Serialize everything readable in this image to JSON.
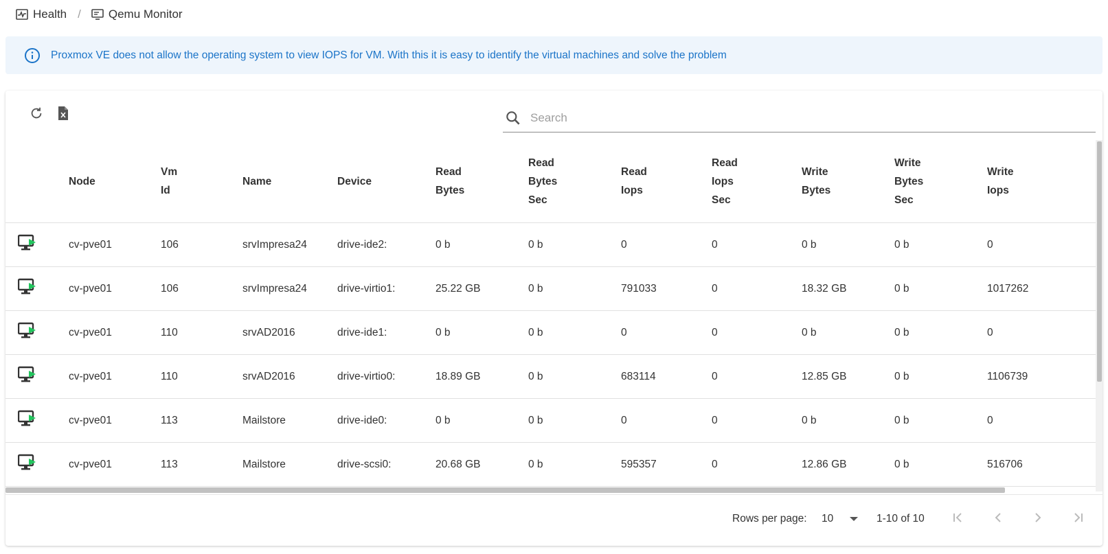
{
  "breadcrumb": {
    "items": [
      {
        "label": "Health",
        "icon": "health-chart-icon"
      },
      {
        "label": "Qemu Monitor",
        "icon": "monitor-icon"
      }
    ],
    "separator": "/"
  },
  "alert": {
    "icon": "info-icon",
    "text": "Proxmox VE does not allow the operating system to view IOPS for VM. With this it is easy to identify the virtual machines and solve the problem",
    "color": "#1b74c8",
    "background": "#eef5fc"
  },
  "toolbar": {
    "refresh_icon": "refresh-icon",
    "export_icon": "excel-export-icon"
  },
  "search": {
    "placeholder": "Search",
    "value": ""
  },
  "table": {
    "columns": [
      "",
      "Node",
      "Vm Id",
      "Name",
      "Device",
      "Read Bytes",
      "Read Bytes Sec",
      "Read Iops",
      "Read Iops Sec",
      "Write Bytes",
      "Write Bytes Sec",
      "Write Iops"
    ],
    "rows": [
      [
        "vm-running-icon",
        "cv-pve01",
        "106",
        "srvImpresa24",
        "drive-ide2:",
        "0 b",
        "0 b",
        "0",
        "0",
        "0 b",
        "0 b",
        "0"
      ],
      [
        "vm-running-icon",
        "cv-pve01",
        "106",
        "srvImpresa24",
        "drive-virtio1:",
        "25.22 GB",
        "0 b",
        "791033",
        "0",
        "18.32 GB",
        "0 b",
        "1017262"
      ],
      [
        "vm-running-icon",
        "cv-pve01",
        "110",
        "srvAD2016",
        "drive-ide1:",
        "0 b",
        "0 b",
        "0",
        "0",
        "0 b",
        "0 b",
        "0"
      ],
      [
        "vm-running-icon",
        "cv-pve01",
        "110",
        "srvAD2016",
        "drive-virtio0:",
        "18.89 GB",
        "0 b",
        "683114",
        "0",
        "12.85 GB",
        "0 b",
        "1106739"
      ],
      [
        "vm-running-icon",
        "cv-pve01",
        "113",
        "Mailstore",
        "drive-ide0:",
        "0 b",
        "0 b",
        "0",
        "0",
        "0 b",
        "0 b",
        "0"
      ],
      [
        "vm-running-icon",
        "cv-pve01",
        "113",
        "Mailstore",
        "drive-scsi0:",
        "20.68 GB",
        "0 b",
        "595357",
        "0",
        "12.86 GB",
        "0 b",
        "516706"
      ],
      [
        "vm-running-icon",
        "",
        "",
        "",
        "",
        "",
        "",
        "",
        "",
        "",
        "",
        ""
      ]
    ]
  },
  "pagination": {
    "rows_per_page_label": "Rows per page:",
    "rows_per_page": "10",
    "range": "1-10 of 10"
  },
  "colors": {
    "running": "#22c55e",
    "text": "#212121"
  }
}
